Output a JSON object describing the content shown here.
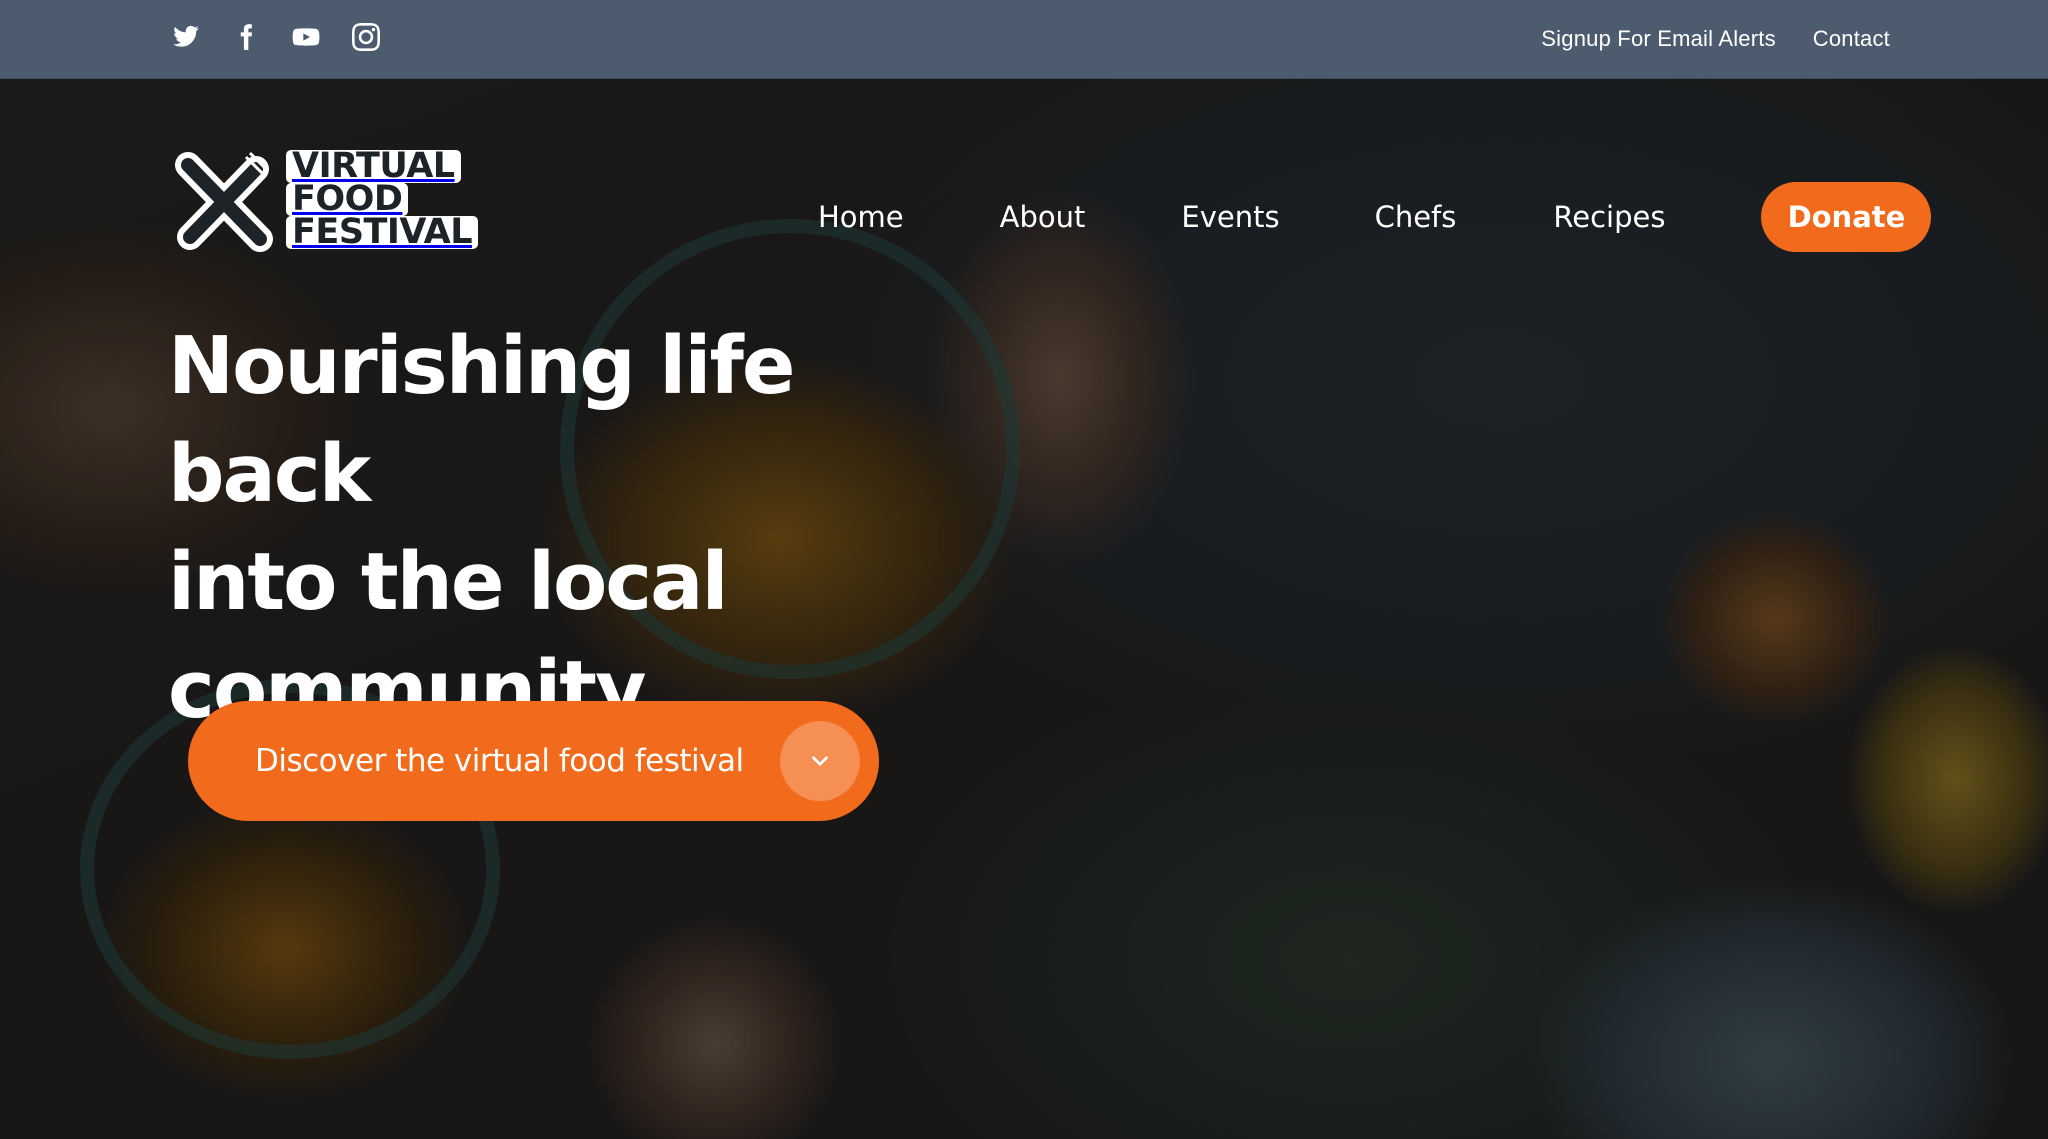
{
  "topbar": {
    "social": [
      {
        "name": "twitter-icon"
      },
      {
        "name": "facebook-icon"
      },
      {
        "name": "youtube-icon"
      },
      {
        "name": "instagram-icon"
      }
    ],
    "links": [
      "Signup For Email Alerts",
      "Contact"
    ]
  },
  "logo": {
    "line1": "VIRTUAL",
    "line2": "FOOD",
    "line3": "FESTIVAL"
  },
  "nav": {
    "items": [
      "Home",
      "About",
      "Events",
      "Chefs",
      "Recipes"
    ],
    "donate": "Donate"
  },
  "hero": {
    "headline_line1": "Nourishing life back",
    "headline_line2": "into the local",
    "headline_line3": "community",
    "cta_label": "Discover the virtual food festival"
  },
  "colors": {
    "topbar": "#4d5b6e",
    "accent": "#f26a1b",
    "text": "#ffffff"
  }
}
